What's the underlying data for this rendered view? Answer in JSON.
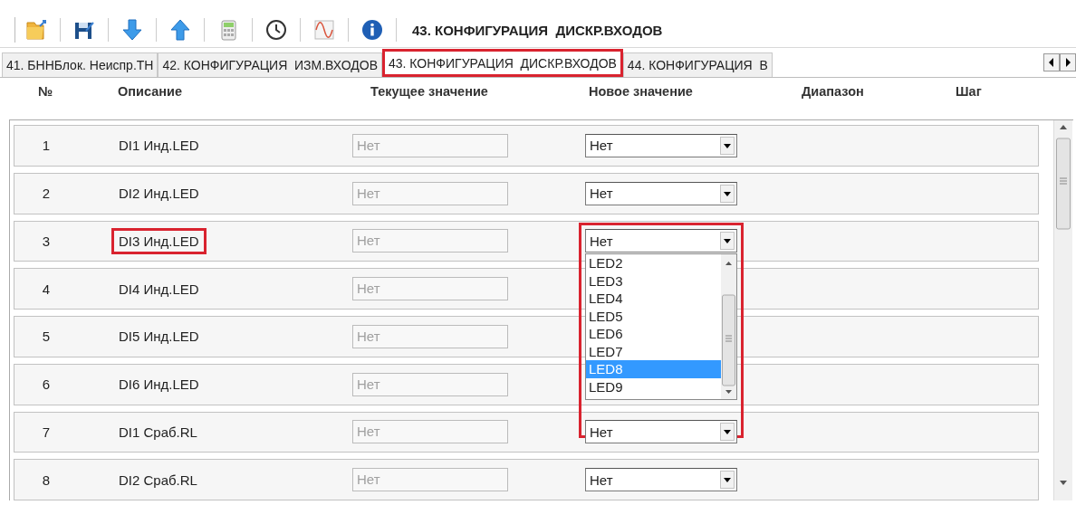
{
  "toolbar": {
    "title": "43. КОНФИГУРАЦИЯ  ДИСКР.ВХОДОВ"
  },
  "tabs": [
    {
      "label": "41. БННБлок. Неиспр.ТН",
      "selected": false,
      "highlighted": false
    },
    {
      "label": "42. КОНФИГУРАЦИЯ  ИЗМ.ВХОДОВ",
      "selected": false,
      "highlighted": false
    },
    {
      "label": "43. КОНФИГУРАЦИЯ  ДИСКР.ВХОДОВ",
      "selected": true,
      "highlighted": true
    },
    {
      "label": "44. КОНФИГУРАЦИЯ  В",
      "selected": false,
      "highlighted": false
    }
  ],
  "columns": [
    "№",
    "Описание",
    "Текущее значение",
    "Новое значение",
    "Диапазон",
    "Шаг"
  ],
  "rows": [
    {
      "number": "1",
      "description": "DI1 Инд.LED",
      "current": "Нет",
      "new": "Нет",
      "highlighted": false
    },
    {
      "number": "2",
      "description": "DI2 Инд.LED",
      "current": "Нет",
      "new": "Нет",
      "highlighted": false
    },
    {
      "number": "3",
      "description": "DI3 Инд.LED",
      "current": "Нет",
      "new": "Нет",
      "highlighted": true,
      "options": [
        {
          "label": "LED2",
          "selected": false
        },
        {
          "label": "LED3",
          "selected": false
        },
        {
          "label": "LED4",
          "selected": false
        },
        {
          "label": "LED5",
          "selected": false
        },
        {
          "label": "LED6",
          "selected": false
        },
        {
          "label": "LED7",
          "selected": false
        },
        {
          "label": "LED8",
          "selected": true
        },
        {
          "label": "LED9",
          "selected": false
        }
      ]
    },
    {
      "number": "4",
      "description": "DI4 Инд.LED",
      "current": "Нет",
      "highlighted": false
    },
    {
      "number": "5",
      "description": "DI5 Инд.LED",
      "current": "Нет",
      "highlighted": false
    },
    {
      "number": "6",
      "description": "DI6 Инд.LED",
      "current": "Нет",
      "highlighted": false
    },
    {
      "number": "7",
      "description": "DI1 Сраб.RL",
      "current": "Нет",
      "new": "Нет",
      "highlighted": false
    },
    {
      "number": "8",
      "description": "DI2 Сраб.RL",
      "current": "Нет",
      "new": "Нет",
      "highlighted": false
    }
  ]
}
